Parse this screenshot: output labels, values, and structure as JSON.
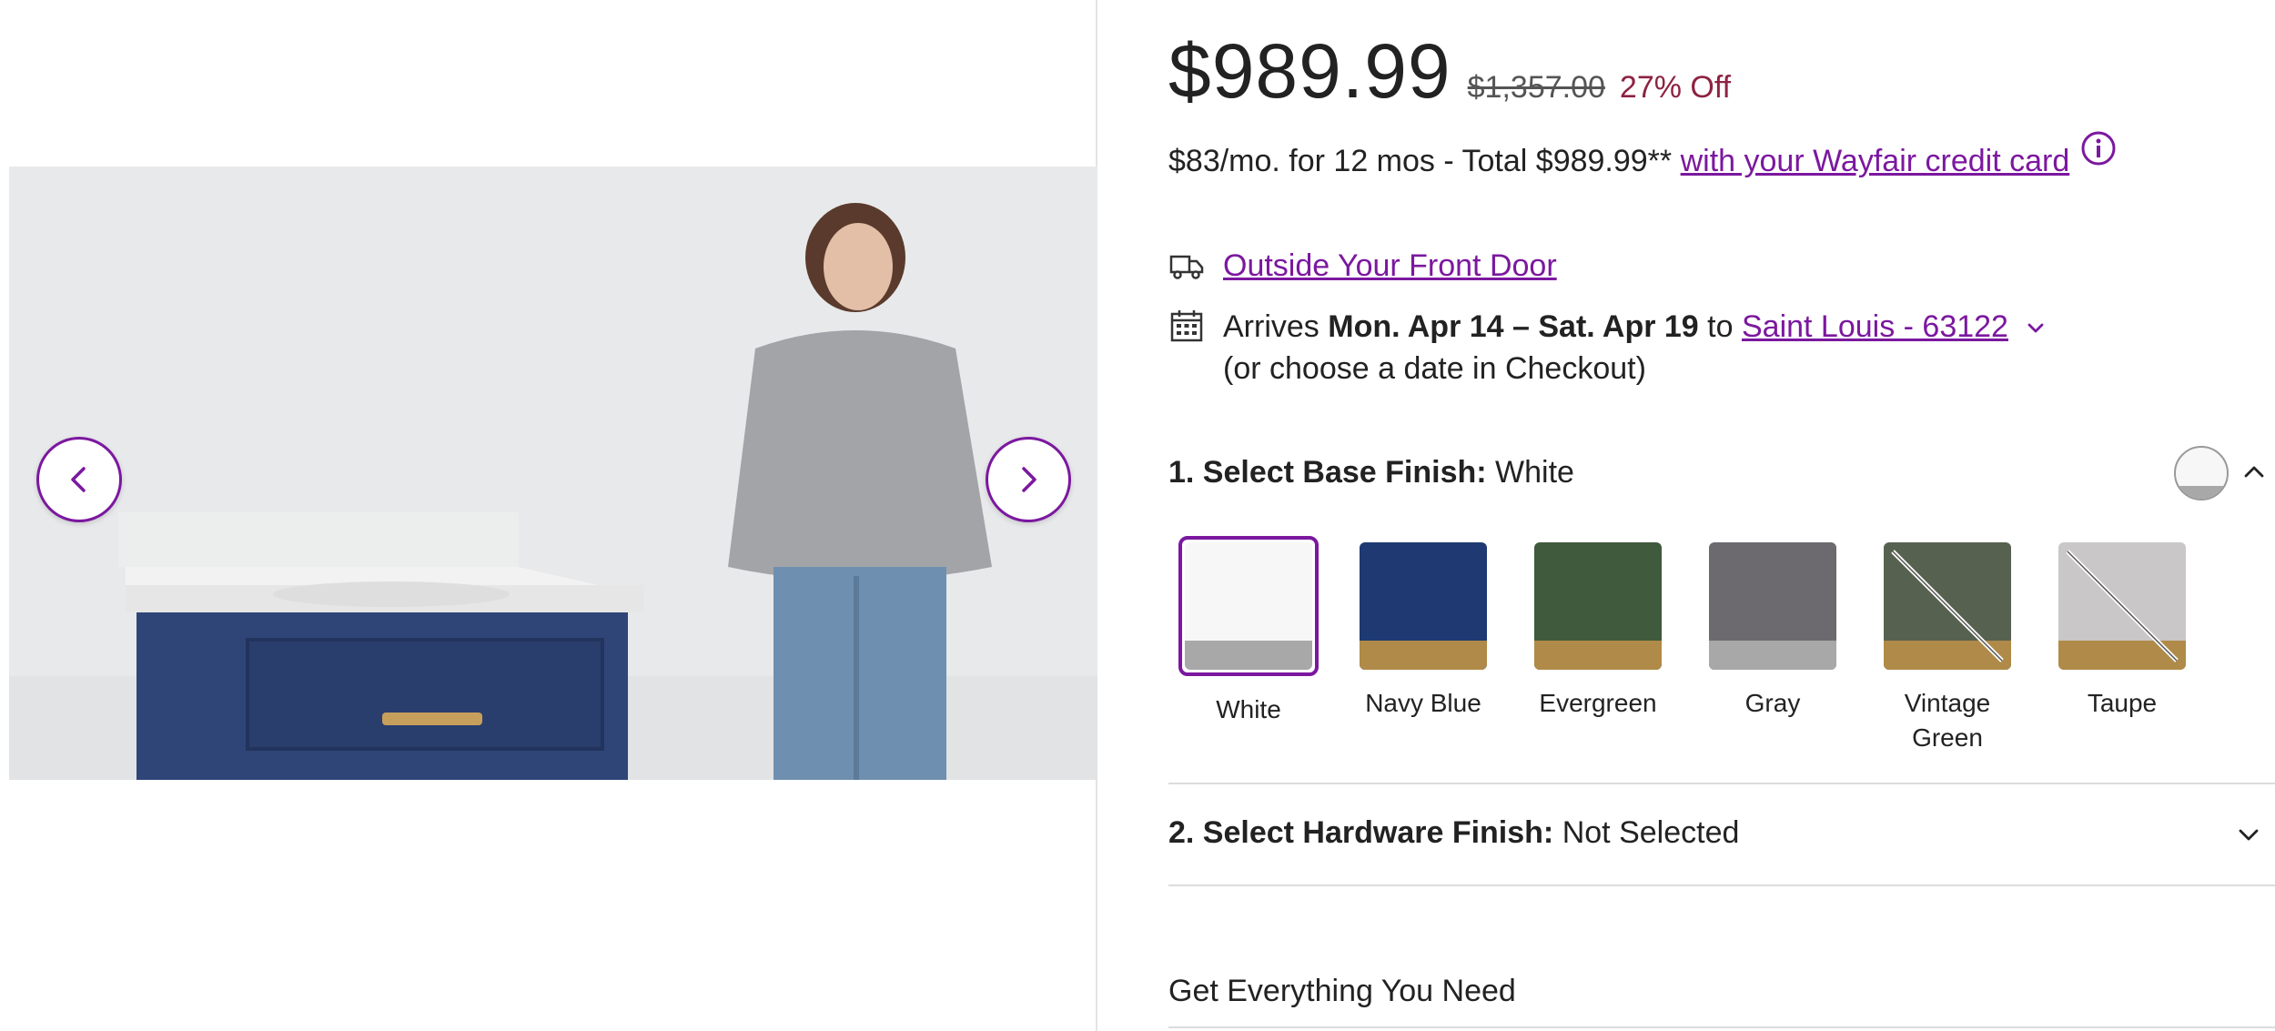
{
  "pricing": {
    "price": "$989.99",
    "original_price": "$1,357.00",
    "discount": "27% Off"
  },
  "financing": {
    "text": "$83/mo. for 12 mos - Total $989.99**",
    "link": "with your Wayfair credit card",
    "info_icon": "info-icon"
  },
  "shipping": {
    "method_link": "Outside Your Front Door",
    "truck_icon": "truck-icon",
    "calendar_icon": "calendar-icon",
    "arrives_prefix": "Arrives",
    "arrives_dates": "Mon. Apr 14 – Sat. Apr 19",
    "to_word": "to",
    "location_link": "Saint Louis - 63122",
    "checkout_note": "(or choose a date in Checkout)"
  },
  "base_finish": {
    "title": "1. Select Base Finish:",
    "selected": "White",
    "options": [
      {
        "label": "White",
        "color": "#f7f7f7",
        "lower": "#a8a8a8",
        "slash": false,
        "selected": true
      },
      {
        "label": "Navy Blue",
        "color": "#1f3a72",
        "lower": "#b08a48",
        "slash": false,
        "selected": false
      },
      {
        "label": "Evergreen",
        "color": "#3f5a3c",
        "lower": "#b08a48",
        "slash": false,
        "selected": false
      },
      {
        "label": "Gray",
        "color": "#6c6a6e",
        "lower": "#a8a8a8",
        "slash": false,
        "selected": false
      },
      {
        "label": "Vintage Green",
        "color": "#56624f",
        "lower": "#b08a48",
        "slash": true,
        "selected": false
      },
      {
        "label": "Taupe",
        "color": "#c9c7c8",
        "lower": "#b08a48",
        "slash": true,
        "selected": false
      }
    ]
  },
  "hardware_finish": {
    "title": "2. Select Hardware Finish:",
    "selected": "Not Selected"
  },
  "sections": {
    "get_everything": "Get Everything You Need"
  },
  "media": {
    "prev_icon": "chevron-left-icon",
    "next_icon": "chevron-right-icon"
  },
  "colors": {
    "accent": "#7b189f",
    "discount": "#8e2242"
  }
}
